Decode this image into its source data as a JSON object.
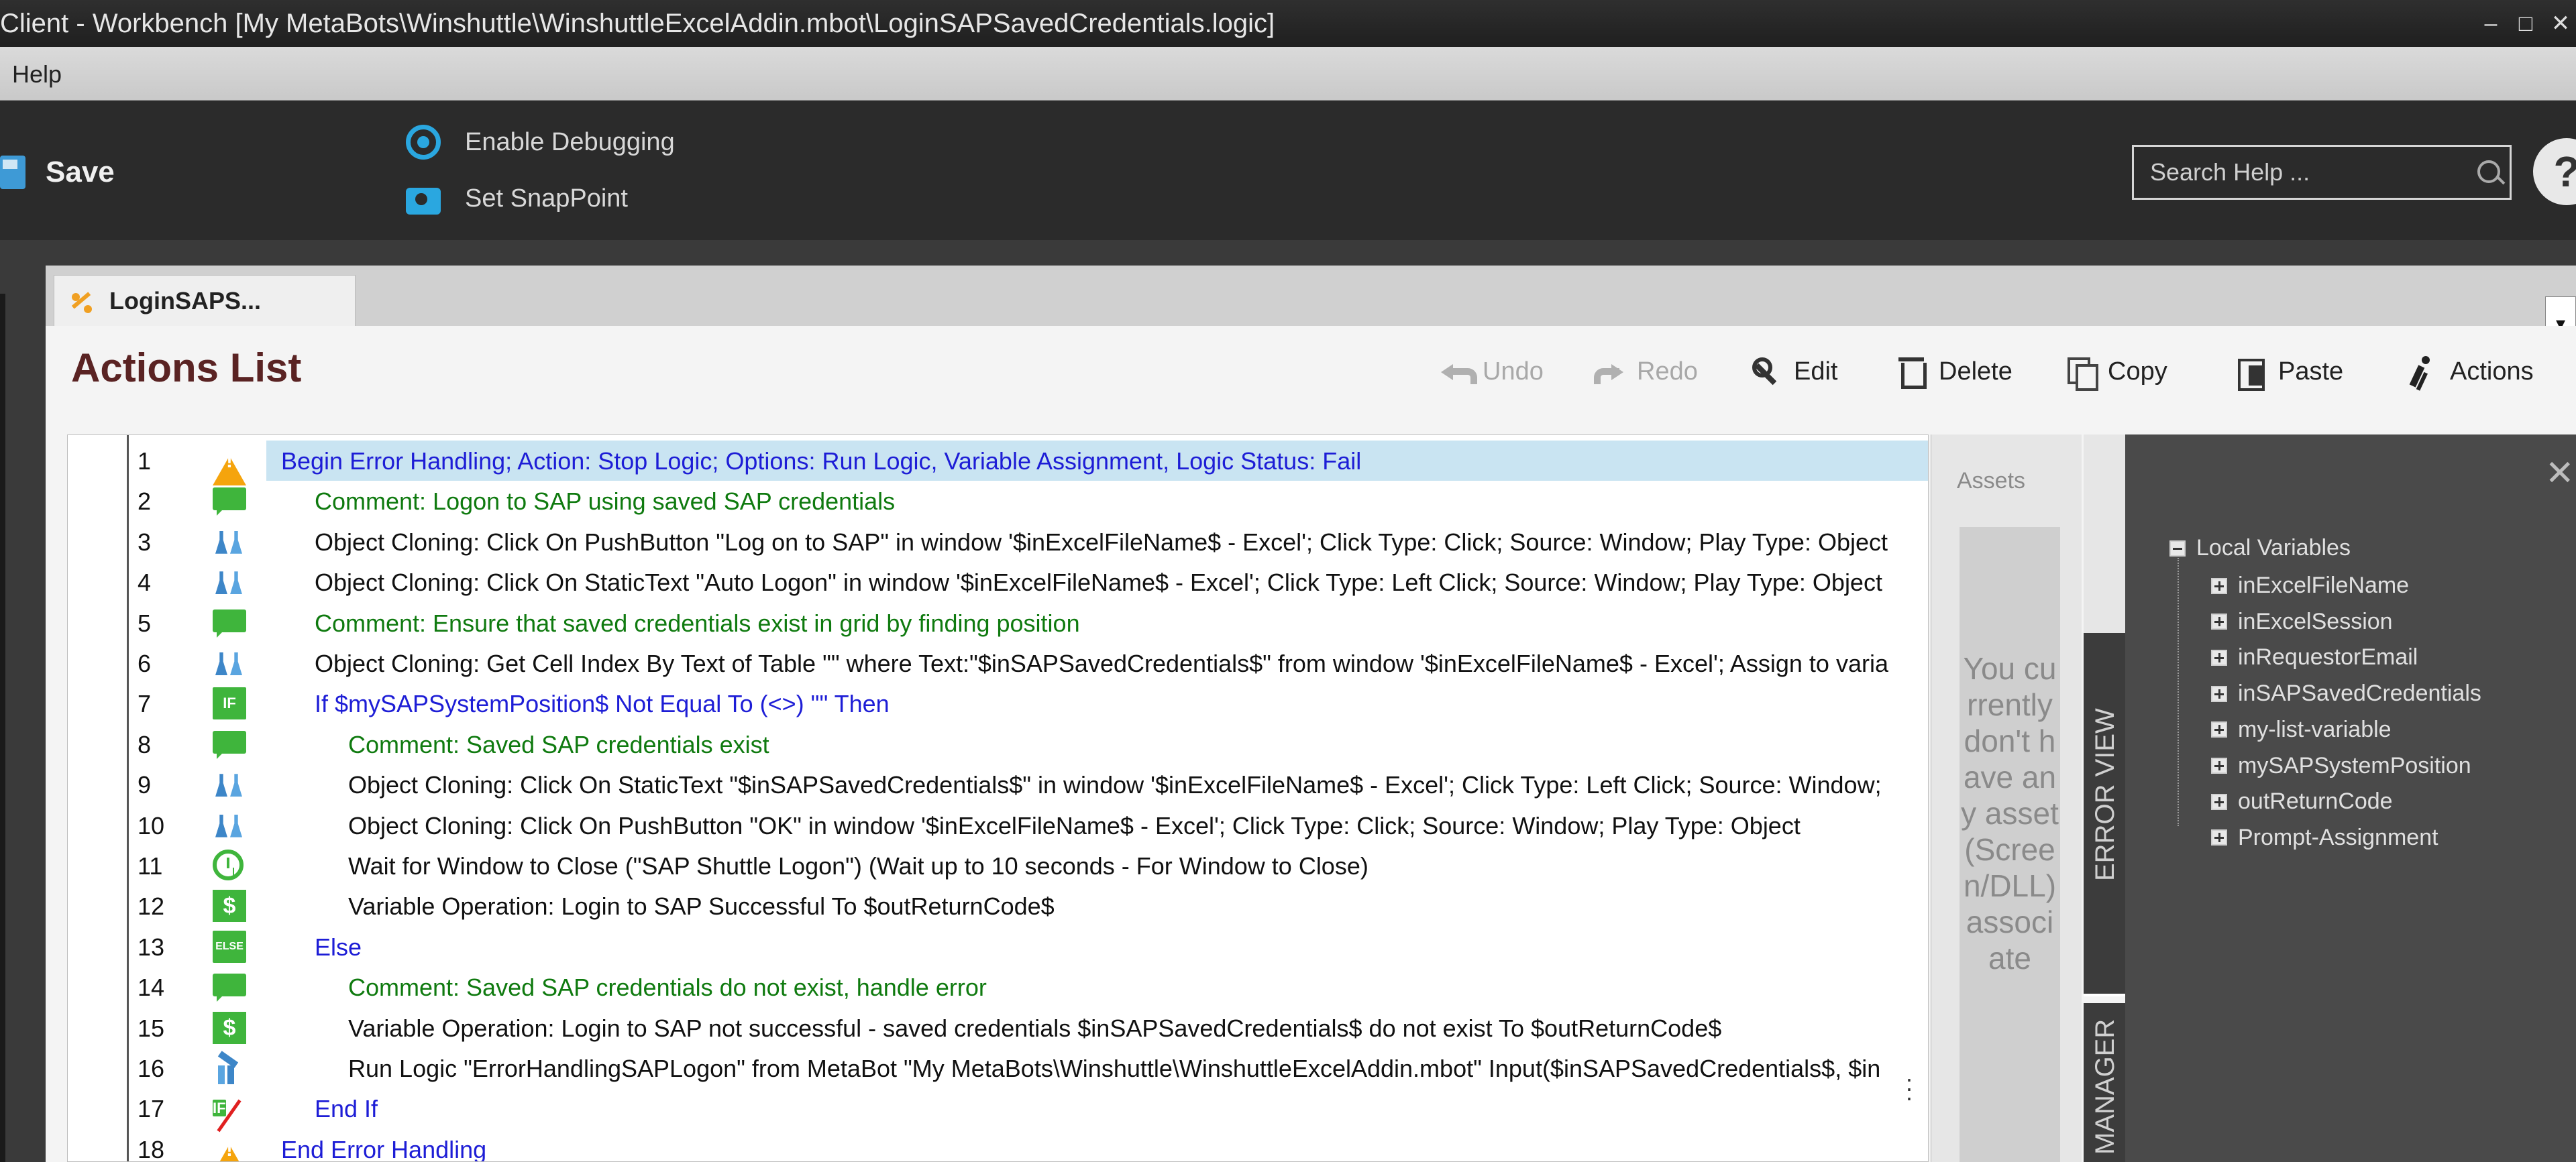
{
  "window": {
    "title": "Client  - Workbench [My MetaBots\\Winshuttle\\WinshuttleExcelAddin.mbot\\LoginSAPSavedCredentials.logic]",
    "minimize": "–",
    "restore": "□",
    "close": "✕"
  },
  "menu": {
    "help": "Help"
  },
  "toolbar": {
    "save_label": "Save",
    "enable_debugging": "Enable Debugging",
    "set_snappoint": "Set SnapPoint",
    "search_placeholder": "Search Help ...",
    "help_glyph": "?"
  },
  "tab": {
    "label": "LoginSAPS...",
    "dropdown": "▾"
  },
  "actions_list": {
    "heading": "Actions List",
    "buttons": {
      "undo": "Undo",
      "redo": "Redo",
      "edit": "Edit",
      "delete": "Delete",
      "copy": "Copy",
      "paste": "Paste",
      "actions": "Actions"
    },
    "rows": [
      {
        "num": "1",
        "icon": "warning-icon",
        "indent": 0,
        "color": "blue",
        "text": "Begin Error Handling; Action: Stop Logic; Options: Run Logic, Variable Assignment,  Logic Status: Fail",
        "selected": true
      },
      {
        "num": "2",
        "icon": "comment-icon",
        "indent": 1,
        "color": "green",
        "text": "Comment: Logon to SAP using saved SAP credentials"
      },
      {
        "num": "3",
        "icon": "object-cloning-icon",
        "indent": 1,
        "color": "black",
        "text": "Object Cloning: Click On PushButton \"Log on to SAP\" in window '$inExcelFileName$ - Excel'; Click Type: Click; Source: Window; Play Type: Object"
      },
      {
        "num": "4",
        "icon": "object-cloning-icon",
        "indent": 1,
        "color": "black",
        "text": "Object Cloning: Click On StaticText \"Auto Logon\" in window '$inExcelFileName$ - Excel'; Click Type: Left Click; Source: Window; Play Type: Object"
      },
      {
        "num": "5",
        "icon": "comment-icon",
        "indent": 1,
        "color": "green",
        "text": "Comment: Ensure that saved credentials exist in grid by finding position"
      },
      {
        "num": "6",
        "icon": "object-cloning-icon",
        "indent": 1,
        "color": "black",
        "text": "Object Cloning: Get Cell Index By Text of Table \"\" where Text:\"$inSAPSavedCredentials$\" from window '$inExcelFileName$ - Excel'; Assign to varia"
      },
      {
        "num": "7",
        "icon": "if-icon",
        "indent": 1,
        "color": "blue",
        "text": "If $mySAPSystemPosition$ Not Equal To (<>) \"\" Then"
      },
      {
        "num": "8",
        "icon": "comment-icon",
        "indent": 2,
        "color": "green",
        "text": "Comment: Saved SAP credentials exist"
      },
      {
        "num": "9",
        "icon": "object-cloning-icon",
        "indent": 2,
        "color": "black",
        "text": "Object Cloning: Click On StaticText \"$inSAPSavedCredentials$\" in window '$inExcelFileName$ - Excel'; Click Type: Left Click; Source: Window;"
      },
      {
        "num": "10",
        "icon": "object-cloning-icon",
        "indent": 2,
        "color": "black",
        "text": "Object Cloning: Click On PushButton \"OK\" in window '$inExcelFileName$ - Excel'; Click Type: Click; Source: Window; Play Type: Object"
      },
      {
        "num": "11",
        "icon": "clock-icon",
        "indent": 2,
        "color": "black",
        "text": "Wait for Window to Close (\"SAP Shuttle Logon\") (Wait up to 10 seconds - For Window to Close)"
      },
      {
        "num": "12",
        "icon": "dollar-icon",
        "indent": 2,
        "color": "black",
        "text": "Variable Operation: Login to SAP Successful To $outReturnCode$"
      },
      {
        "num": "13",
        "icon": "else-icon",
        "indent": 1,
        "color": "blue",
        "text": "Else"
      },
      {
        "num": "14",
        "icon": "comment-icon",
        "indent": 2,
        "color": "green",
        "text": "Comment: Saved SAP credentials do not exist, handle error"
      },
      {
        "num": "15",
        "icon": "dollar-icon",
        "indent": 2,
        "color": "black",
        "text": "Variable Operation: Login to SAP not successful - saved credentials $inSAPSavedCredentials$ do not exist To $outReturnCode$"
      },
      {
        "num": "16",
        "icon": "run-logic-icon",
        "indent": 2,
        "color": "black",
        "text": "Run Logic \"ErrorHandlingSAPLogon\" from MetaBot \"My MetaBots\\Winshuttle\\WinshuttleExcelAddin.mbot\" Input($inSAPSavedCredentials$, $in"
      },
      {
        "num": "17",
        "icon": "end-if-icon",
        "indent": 1,
        "color": "blue",
        "text": "End If"
      },
      {
        "num": "18",
        "icon": "warning-icon",
        "indent": 0,
        "color": "blue",
        "text": "End Error Handling"
      }
    ]
  },
  "icon_labels": {
    "if": "IF",
    "else": "ELSE",
    "endif": "IF",
    "dollar": "$"
  },
  "assets": {
    "title": "Assets",
    "message": "You currently don't have any asset (Screen/DLL) associate"
  },
  "side_tabs": {
    "error_view": "ERROR VIEW",
    "manager": "MANAGER"
  },
  "variables": {
    "close": "✕",
    "root": "Local Variables",
    "items": [
      "inExcelFileName",
      "inExcelSession",
      "inRequestorEmail",
      "inSAPSavedCredentials",
      "my-list-variable",
      "mySAPSystemPosition",
      "outReturnCode",
      "Prompt-Assignment"
    ]
  },
  "colors": {
    "blue": "#1d1dd6",
    "green": "#0f7a0f",
    "black": "#111111",
    "heading": "#5a2323",
    "selection": "#c9e4f2"
  }
}
